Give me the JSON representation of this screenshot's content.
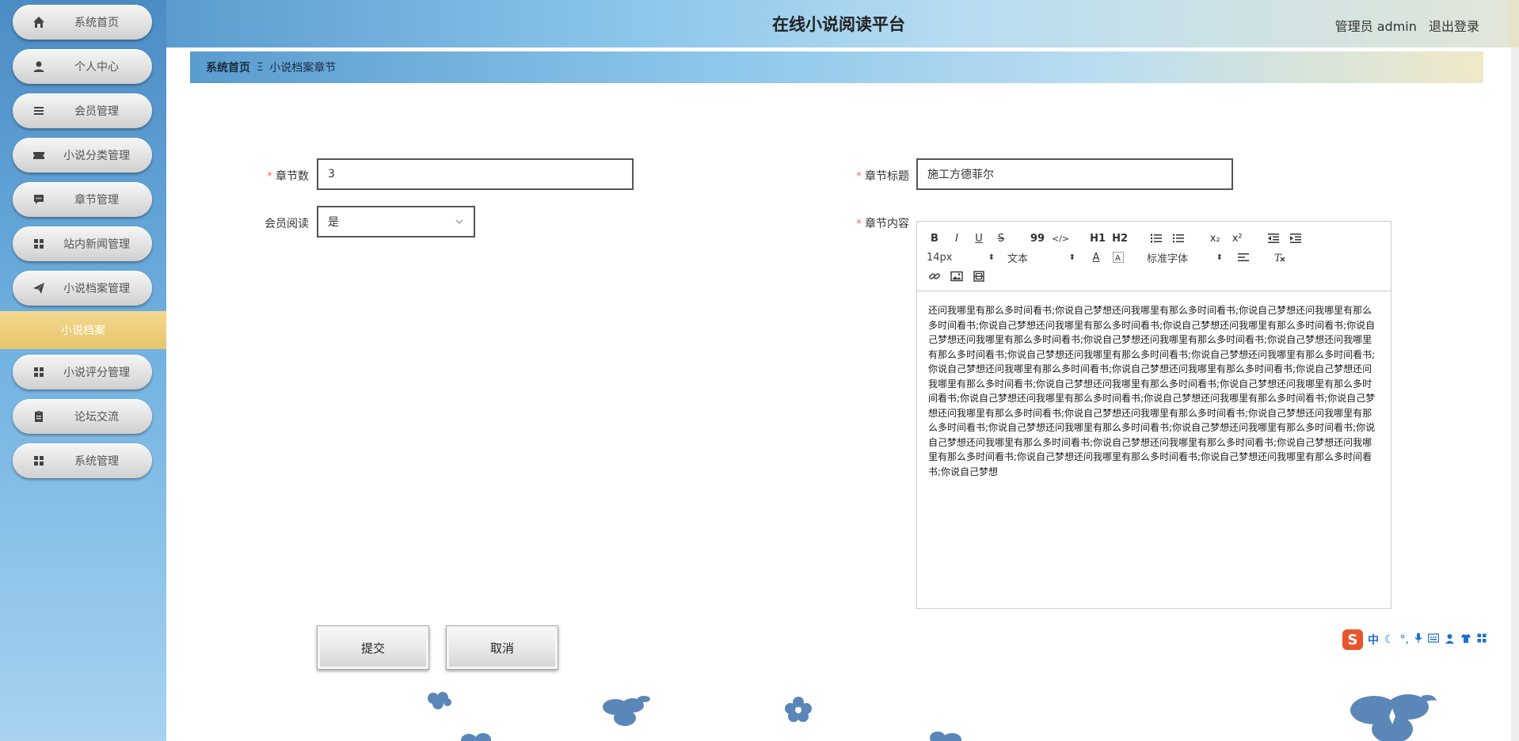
{
  "app": {
    "title": "在线小说阅读平台"
  },
  "header": {
    "user_label": "管理员 admin",
    "logout_label": "退出登录"
  },
  "sidebar": {
    "items": [
      {
        "label": "系统首页",
        "icon": "home-icon"
      },
      {
        "label": "个人中心",
        "icon": "person-icon"
      },
      {
        "label": "会员管理",
        "icon": "list-icon"
      },
      {
        "label": "小说分类管理",
        "icon": "ticket-icon"
      },
      {
        "label": "章节管理",
        "icon": "chat-icon"
      },
      {
        "label": "站内新闻管理",
        "icon": "grid-icon"
      },
      {
        "label": "小说档案管理",
        "icon": "paper-plane-icon"
      },
      {
        "label": "小说评分管理",
        "icon": "grid-icon"
      },
      {
        "label": "论坛交流",
        "icon": "clipboard-icon"
      },
      {
        "label": "系统管理",
        "icon": "grid-icon"
      }
    ],
    "active_sub": "小说档案"
  },
  "breadcrumb": {
    "home": "系统首页",
    "separator": "Ξ",
    "current": "小说档案章节"
  },
  "form": {
    "chapter_num": {
      "label": "章节数",
      "value": "3"
    },
    "chapter_title": {
      "label": "章节标题",
      "value": "施工方德菲尔"
    },
    "member_read": {
      "label": "会员阅读",
      "value": "是"
    },
    "chapter_content": {
      "label": "章节内容"
    },
    "submit_label": "提交",
    "cancel_label": "取消"
  },
  "editor": {
    "font_size": "14px",
    "header_type": "文本",
    "font_family": "标准字体",
    "toolbar_labels": {
      "h1": "H1",
      "h2": "H2",
      "quote": "99",
      "code": "</>",
      "sub": "x₂",
      "sup": "x²"
    },
    "content": "还问我哪里有那么多时间看书;你说自己梦想还问我哪里有那么多时间看书;你说自己梦想还问我哪里有那么多时间看书;你说自己梦想还问我哪里有那么多时间看书;你说自己梦想还问我哪里有那么多时间看书;你说自己梦想还问我哪里有那么多时间看书;你说自己梦想还问我哪里有那么多时间看书;你说自己梦想还问我哪里有那么多时间看书;你说自己梦想还问我哪里有那么多时间看书;你说自己梦想还问我哪里有那么多时间看书;你说自己梦想还问我哪里有那么多时间看书;你说自己梦想还问我哪里有那么多时间看书;你说自己梦想还问我哪里有那么多时间看书;你说自己梦想还问我哪里有那么多时间看书;你说自己梦想还问我哪里有那么多时间看书;你说自己梦想还问我哪里有那么多时间看书;你说自己梦想还问我哪里有那么多时间看书;你说自己梦想还问我哪里有那么多时间看书;你说自己梦想还问我哪里有那么多时间看书;你说自己梦想还问我哪里有那么多时间看书;你说自己梦想还问我哪里有那么多时间看书;你说自己梦想还问我哪里有那么多时间看书;你说自己梦想还问我哪里有那么多时间看书;你说自己梦想还问我哪里有那么多时间看书;你说自己梦想还问我哪里有那么多时间看书;你说自己梦想还问我哪里有那么多时间看书;你说自己梦想还问我哪里有那么多时间看书;你说自己梦想"
  },
  "ime": {
    "logo": "S",
    "mode": "中"
  },
  "colors": {
    "sidebar_top": "#4a8cc4",
    "active_sub": "#e8c46a",
    "required": "#f56c6c",
    "flower": "#5b86b8"
  }
}
